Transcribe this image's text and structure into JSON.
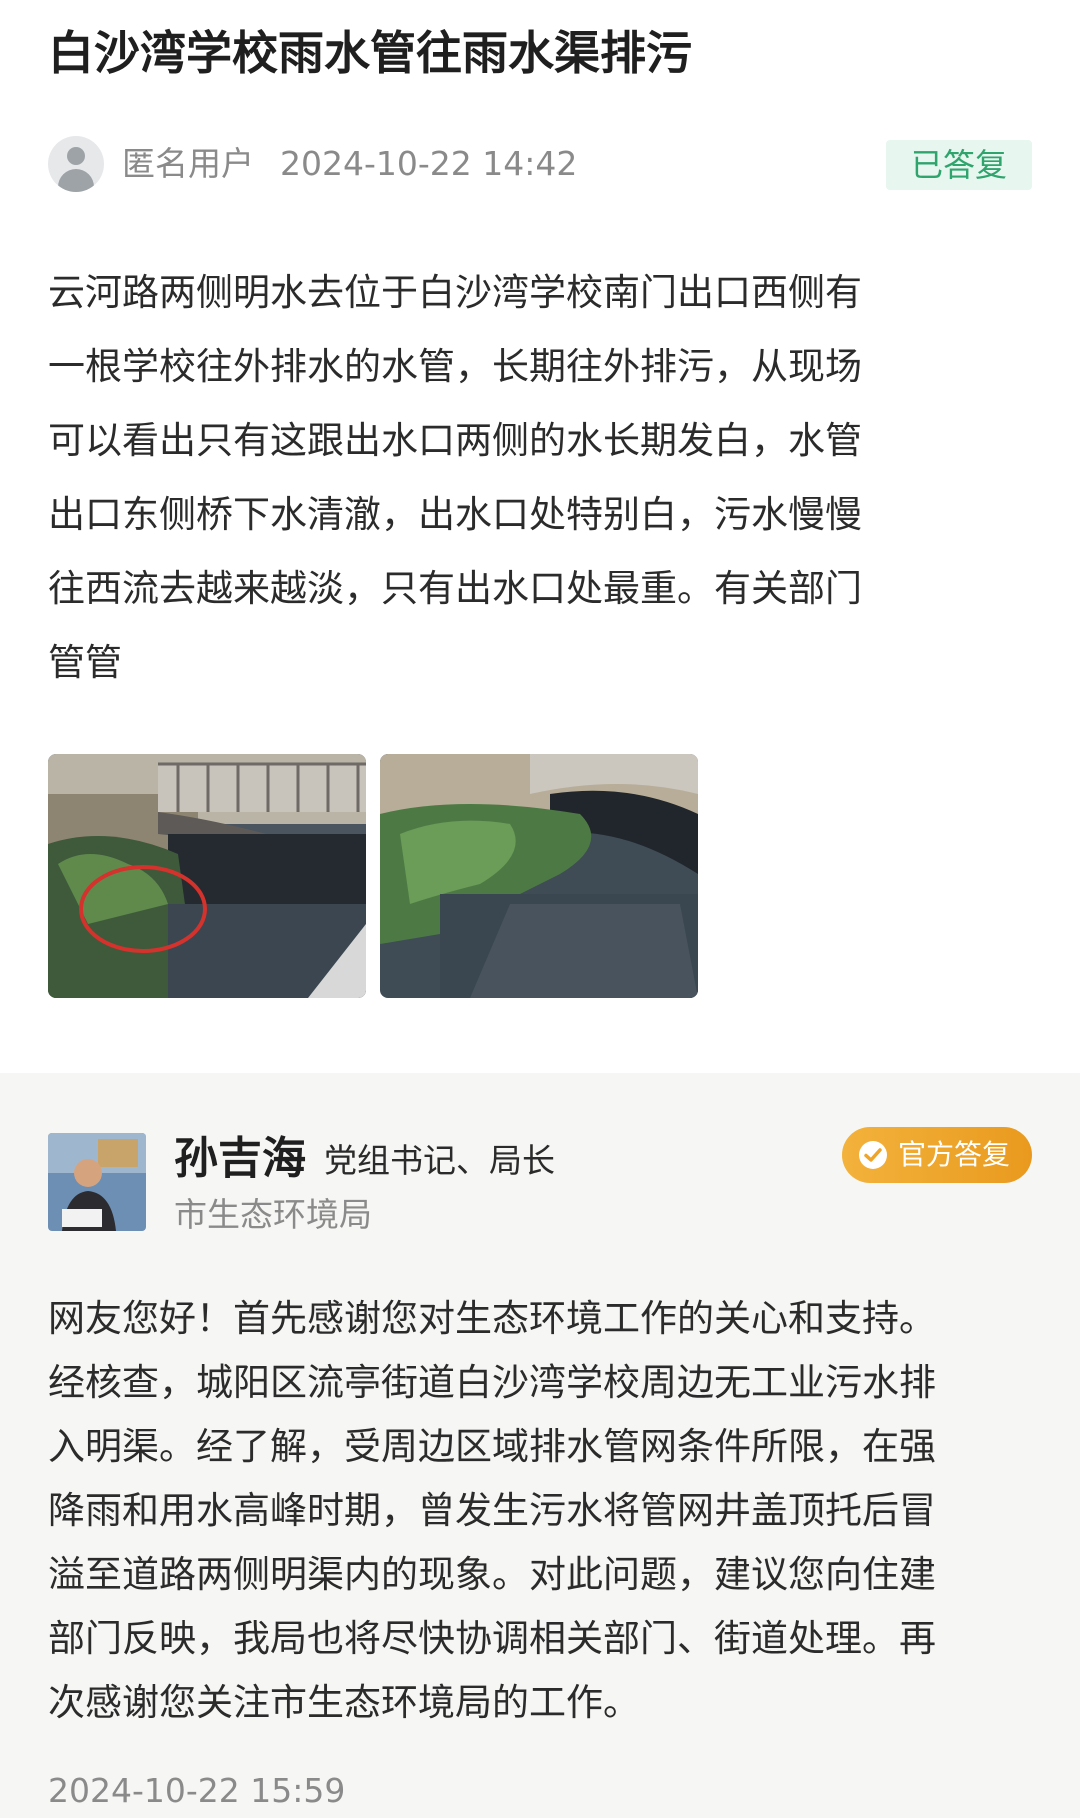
{
  "post": {
    "title": "白沙湾学校雨水管往雨水渠排污",
    "author": "匿名用户",
    "timestamp": "2024-10-22 14:42",
    "status": "已答复",
    "content_lines": [
      "云河路两侧明水去位于白沙湾学校南门出口西侧有",
      "一根学校往外排水的水管，长期往外排污，从现场",
      "可以看出只有这跟出水口两侧的水长期发白，水管",
      "出口东侧桥下水清澈，出水口处特别白，污水慢慢",
      "往西流去越来越淡，只有出水口处最重。有关部门",
      "管管"
    ]
  },
  "reply": {
    "official_name": "孙吉海",
    "official_title": "党组书记、局长",
    "department": "市生态环境局",
    "badge": "官方答复",
    "content_lines": [
      "网友您好！首先感谢您对生态环境工作的关心和支持。",
      "经核查，城阳区流亭街道白沙湾学校周边无工业污水排",
      "入明渠。经了解，受周边区域排水管网条件所限，在强",
      "降雨和用水高峰时期，曾发生污水将管网井盖顶托后冒",
      "溢至道路两侧明渠内的现象。对此问题，建议您向住建",
      "部门反映，我局也将尽快协调相关部门、街道处理。再",
      "次感谢您关注市生态环境局的工作。"
    ],
    "timestamp": "2024-10-22 15:59"
  },
  "colors": {
    "status_green": "#2fa46c",
    "status_green_bg": "#e7f6ef",
    "badge_orange": "#eea52a",
    "reply_bg": "#f6f6f4",
    "meta_gray": "#8a8a8a"
  },
  "icons": {
    "anonymous_avatar": "user-silhouette-icon",
    "official_badge_icon": "verified-check-icon"
  }
}
